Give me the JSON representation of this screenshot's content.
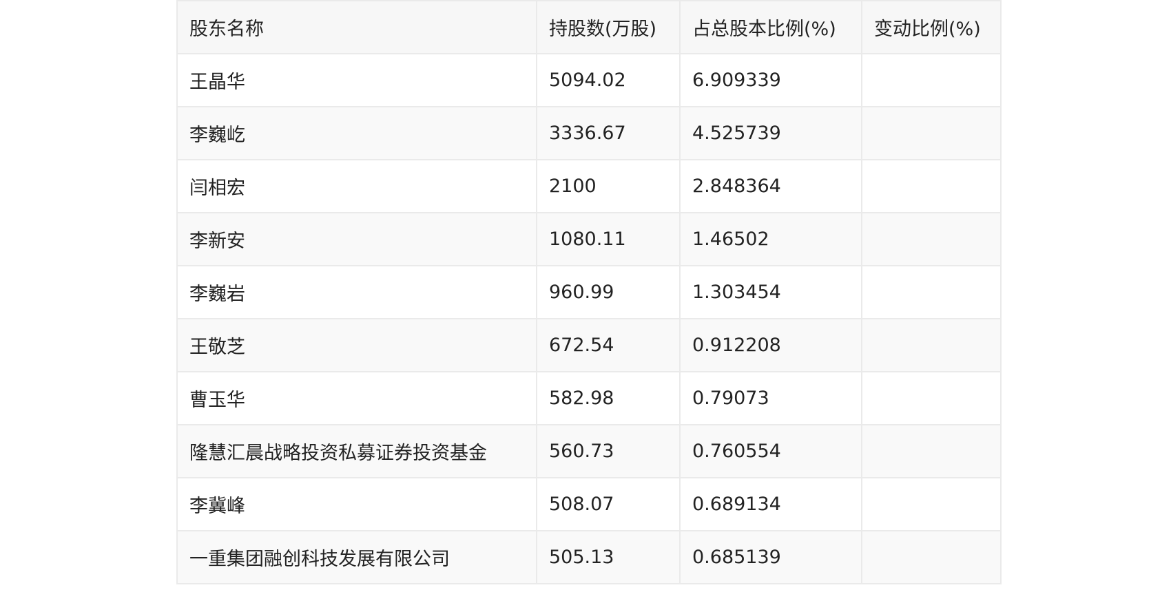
{
  "table": {
    "headers": [
      "股东名称",
      "持股数(万股)",
      "占总股本比例(%)",
      "变动比例(%)"
    ],
    "rows": [
      [
        "王晶华",
        "5094.02",
        "6.909339",
        ""
      ],
      [
        "李巍屹",
        "3336.67",
        "4.525739",
        ""
      ],
      [
        "闫相宏",
        "2100",
        "2.848364",
        ""
      ],
      [
        "李新安",
        "1080.11",
        "1.46502",
        ""
      ],
      [
        "李巍岩",
        "960.99",
        "1.303454",
        ""
      ],
      [
        "王敬芝",
        "672.54",
        "0.912208",
        ""
      ],
      [
        "曹玉华",
        "582.98",
        "0.79073",
        ""
      ],
      [
        "隆慧汇晨战略投资私募证券投资基金",
        "560.73",
        "0.760554",
        ""
      ],
      [
        "李冀峰",
        "508.07",
        "0.689134",
        ""
      ],
      [
        "一重集团融创科技发展有限公司",
        "505.13",
        "0.685139",
        ""
      ]
    ]
  }
}
